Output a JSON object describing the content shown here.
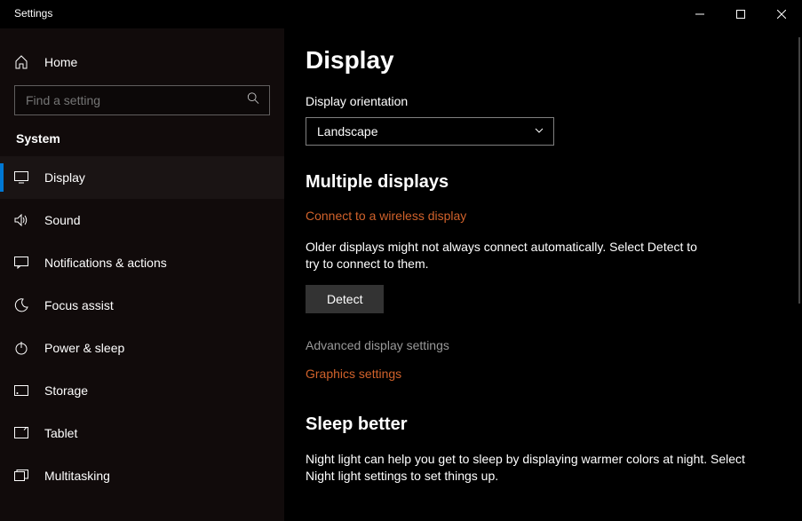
{
  "titlebar": {
    "title": "Settings"
  },
  "sidebar": {
    "home": "Home",
    "searchPlaceholder": "Find a setting",
    "section": "System",
    "items": [
      {
        "label": "Display",
        "icon": "display-icon",
        "active": true
      },
      {
        "label": "Sound",
        "icon": "sound-icon"
      },
      {
        "label": "Notifications & actions",
        "icon": "notify-icon"
      },
      {
        "label": "Focus assist",
        "icon": "moon-icon"
      },
      {
        "label": "Power & sleep",
        "icon": "power-icon"
      },
      {
        "label": "Storage",
        "icon": "storage-icon"
      },
      {
        "label": "Tablet",
        "icon": "tablet-icon"
      },
      {
        "label": "Multitasking",
        "icon": "multitask-icon"
      }
    ]
  },
  "content": {
    "title": "Display",
    "orientation": {
      "label": "Display orientation",
      "value": "Landscape"
    },
    "multi": {
      "heading": "Multiple displays",
      "wirelessLink": "Connect to a wireless display",
      "desc": "Older displays might not always connect automatically. Select Detect to try to connect to them.",
      "detectBtn": "Detect",
      "advLink": "Advanced display settings",
      "gfxLink": "Graphics settings"
    },
    "sleep": {
      "heading": "Sleep better",
      "desc": "Night light can help you get to sleep by displaying warmer colors at night. Select Night light settings to set things up."
    }
  }
}
